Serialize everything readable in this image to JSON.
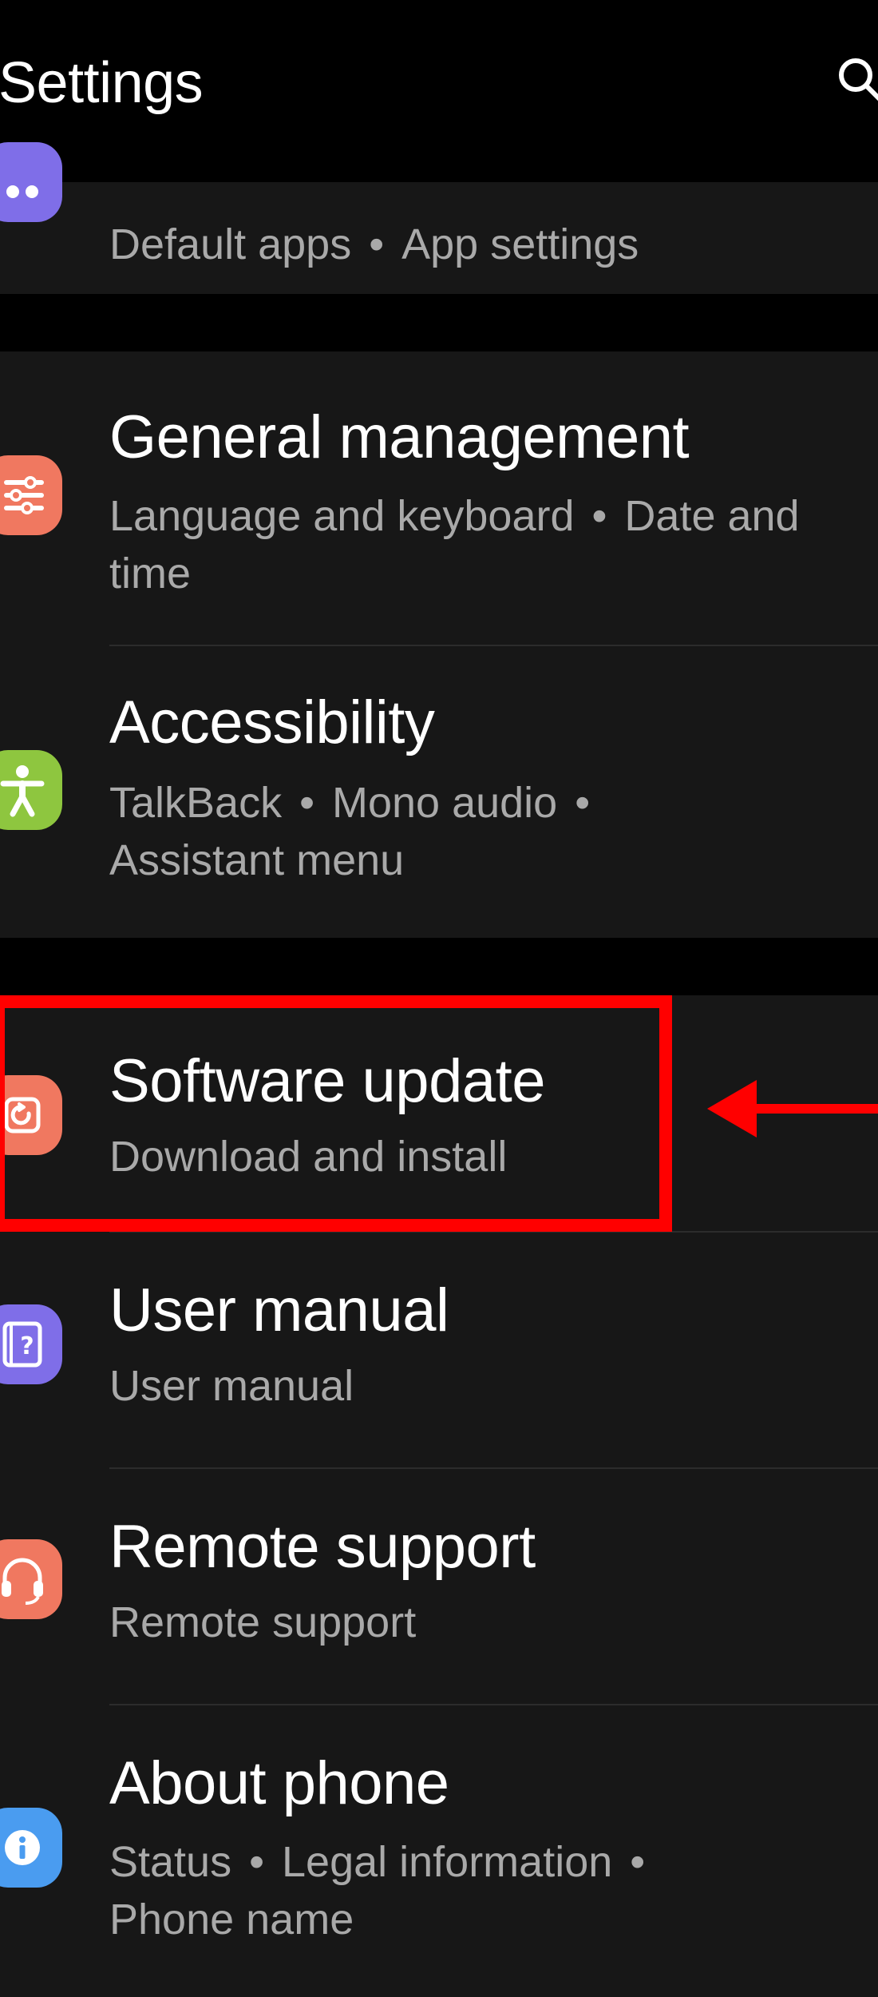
{
  "header": {
    "title": "Settings",
    "search_icon": "search-icon"
  },
  "rows": {
    "apps": {
      "subtitle_parts": [
        "Default apps",
        "App settings"
      ],
      "icon": "apps-icon",
      "icon_color": "#7f6ee8"
    },
    "general_management": {
      "title": "General management",
      "subtitle_parts": [
        "Language and keyboard",
        "Date and"
      ],
      "subtitle_line2": "time",
      "icon": "sliders-icon",
      "icon_color": "#f07860"
    },
    "accessibility": {
      "title": "Accessibility",
      "subtitle_parts": [
        "TalkBack",
        "Mono audio"
      ],
      "subtitle_line2": "Assistant menu",
      "icon": "accessibility-icon",
      "icon_color": "#8ec63f"
    },
    "software_update": {
      "title": "Software update",
      "subtitle": "Download and install",
      "icon": "software-update-icon",
      "icon_color": "#f07860"
    },
    "user_manual": {
      "title": "User manual",
      "subtitle": "User manual",
      "icon": "user-manual-icon",
      "icon_color": "#7f6ee8"
    },
    "remote_support": {
      "title": "Remote support",
      "subtitle": "Remote support",
      "icon": "headset-icon",
      "icon_color": "#f07860"
    },
    "about_phone": {
      "title": "About phone",
      "subtitle_parts": [
        "Status",
        "Legal information"
      ],
      "subtitle_line2": "Phone name",
      "icon": "info-icon",
      "icon_color": "#4a9cf0"
    }
  },
  "separator": "•",
  "annotation": {
    "highlight_color": "#ff0000"
  }
}
